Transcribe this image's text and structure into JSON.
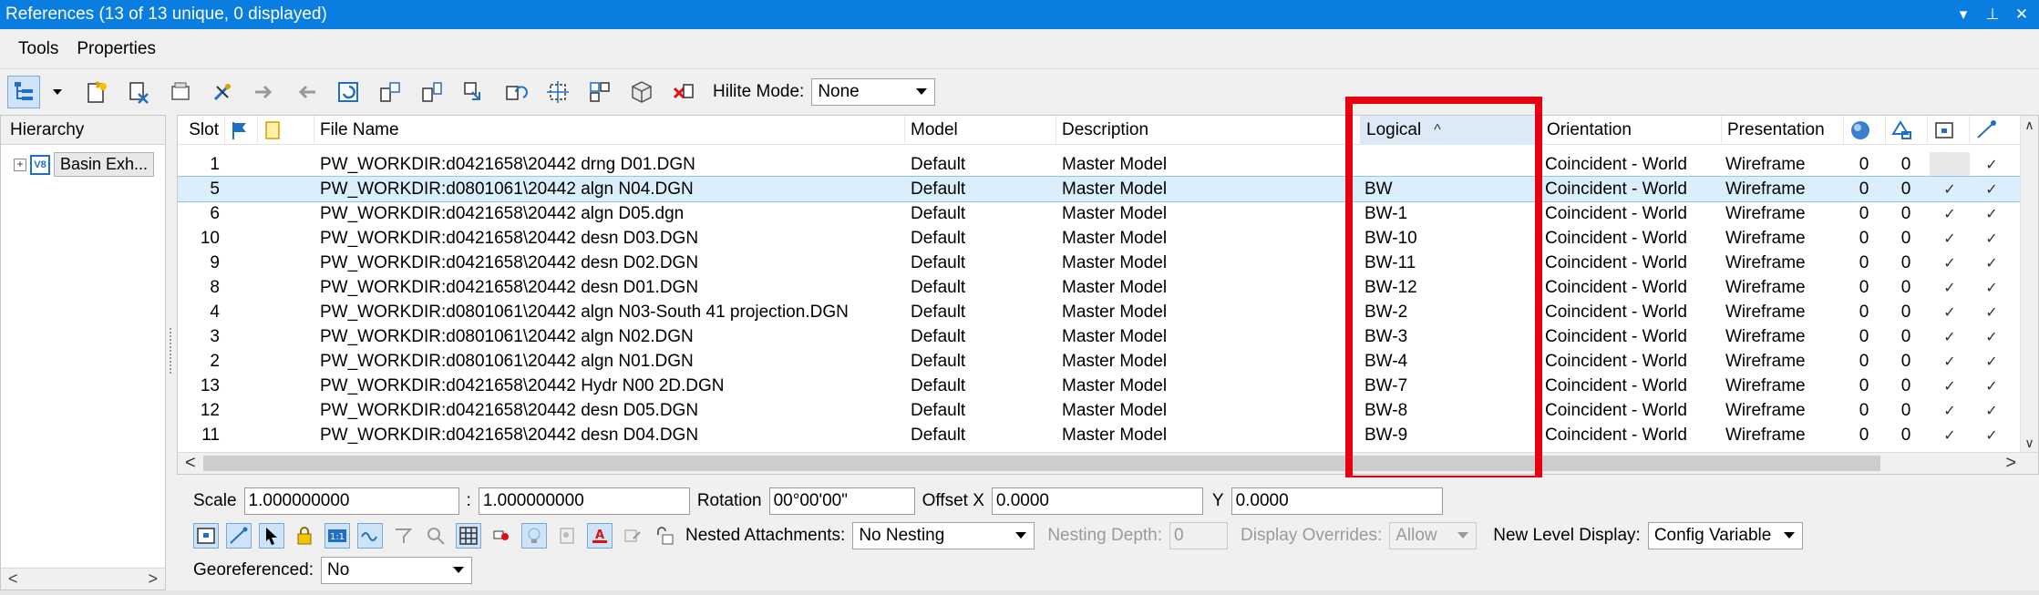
{
  "window": {
    "title": "References (13 of 13 unique, 0 displayed)",
    "dropdown_glyph": "▾",
    "pin_glyph": "⊥",
    "close_glyph": "✕"
  },
  "menu": {
    "items": [
      "Tools",
      "Properties"
    ]
  },
  "toolbar": {
    "hilite_label": "Hilite Mode:",
    "hilite_value": "None"
  },
  "hierarchy": {
    "header": "Hierarchy",
    "node_label": "Basin Exh...",
    "expander": "+",
    "node_icon_text": "V8"
  },
  "table": {
    "columns": [
      {
        "key": "slot",
        "label": "Slot"
      },
      {
        "key": "flag",
        "label": "",
        "icon": "flag-icon"
      },
      {
        "key": "note",
        "label": "",
        "icon": "note-icon"
      },
      {
        "key": "file",
        "label": "File Name"
      },
      {
        "key": "model",
        "label": "Model"
      },
      {
        "key": "desc",
        "label": "Description"
      },
      {
        "key": "logical",
        "label": "Logical",
        "sorted": "ascending"
      },
      {
        "key": "orient",
        "label": "Orientation"
      },
      {
        "key": "pres",
        "label": "Presentation"
      },
      {
        "key": "c1",
        "label": "",
        "icon": "sphere-icon"
      },
      {
        "key": "c2",
        "label": "",
        "icon": "shapes-icon"
      },
      {
        "key": "c3",
        "label": "",
        "icon": "display-icon"
      },
      {
        "key": "c4",
        "label": "",
        "icon": "snap-icon"
      }
    ],
    "sort_indicator": "^",
    "rows": [
      {
        "slot": "1",
        "file": "PW_WORKDIR:d0421658\\20442 drng D01.DGN",
        "model": "Default",
        "desc": "Master Model",
        "logical": "",
        "orient": "Coincident - World",
        "pres": "Wireframe",
        "c1": "0",
        "c2": "0",
        "c3": "",
        "c4": "✓"
      },
      {
        "slot": "5",
        "file": "PW_WORKDIR:d0801061\\20442 algn N04.DGN",
        "model": "Default",
        "desc": "Master Model",
        "logical": "BW",
        "orient": "Coincident - World",
        "pres": "Wireframe",
        "c1": "0",
        "c2": "0",
        "c3": "✓",
        "c4": "✓",
        "selected": true
      },
      {
        "slot": "6",
        "file": "PW_WORKDIR:d0421658\\20442 algn D05.dgn",
        "model": "Default",
        "desc": "Master Model",
        "logical": "BW-1",
        "orient": "Coincident - World",
        "pres": "Wireframe",
        "c1": "0",
        "c2": "0",
        "c3": "✓",
        "c4": "✓"
      },
      {
        "slot": "10",
        "file": "PW_WORKDIR:d0421658\\20442 desn D03.DGN",
        "model": "Default",
        "desc": "Master Model",
        "logical": "BW-10",
        "orient": "Coincident - World",
        "pres": "Wireframe",
        "c1": "0",
        "c2": "0",
        "c3": "✓",
        "c4": "✓"
      },
      {
        "slot": "9",
        "file": "PW_WORKDIR:d0421658\\20442 desn D02.DGN",
        "model": "Default",
        "desc": "Master Model",
        "logical": "BW-11",
        "orient": "Coincident - World",
        "pres": "Wireframe",
        "c1": "0",
        "c2": "0",
        "c3": "✓",
        "c4": "✓"
      },
      {
        "slot": "8",
        "file": "PW_WORKDIR:d0421658\\20442 desn D01.DGN",
        "model": "Default",
        "desc": "Master Model",
        "logical": "BW-12",
        "orient": "Coincident - World",
        "pres": "Wireframe",
        "c1": "0",
        "c2": "0",
        "c3": "✓",
        "c4": "✓"
      },
      {
        "slot": "4",
        "file": "PW_WORKDIR:d0801061\\20442 algn N03-South 41 projection.DGN",
        "model": "Default",
        "desc": "Master Model",
        "logical": "BW-2",
        "orient": "Coincident - World",
        "pres": "Wireframe",
        "c1": "0",
        "c2": "0",
        "c3": "✓",
        "c4": "✓"
      },
      {
        "slot": "3",
        "file": "PW_WORKDIR:d0801061\\20442 algn N02.DGN",
        "model": "Default",
        "desc": "Master Model",
        "logical": "BW-3",
        "orient": "Coincident - World",
        "pres": "Wireframe",
        "c1": "0",
        "c2": "0",
        "c3": "✓",
        "c4": "✓"
      },
      {
        "slot": "2",
        "file": "PW_WORKDIR:d0801061\\20442 algn N01.DGN",
        "model": "Default",
        "desc": "Master Model",
        "logical": "BW-4",
        "orient": "Coincident - World",
        "pres": "Wireframe",
        "c1": "0",
        "c2": "0",
        "c3": "✓",
        "c4": "✓"
      },
      {
        "slot": "13",
        "file": "PW_WORKDIR:d0421658\\20442 Hydr N00 2D.DGN",
        "model": "Default",
        "desc": "Master Model",
        "logical": "BW-7",
        "orient": "Coincident - World",
        "pres": "Wireframe",
        "c1": "0",
        "c2": "0",
        "c3": "✓",
        "c4": "✓"
      },
      {
        "slot": "12",
        "file": "PW_WORKDIR:d0421658\\20442 desn D05.DGN",
        "model": "Default",
        "desc": "Master Model",
        "logical": "BW-8",
        "orient": "Coincident - World",
        "pres": "Wireframe",
        "c1": "0",
        "c2": "0",
        "c3": "✓",
        "c4": "✓"
      },
      {
        "slot": "11",
        "file": "PW_WORKDIR:d0421658\\20442 desn D04.DGN",
        "model": "Default",
        "desc": "Master Model",
        "logical": "BW-9",
        "orient": "Coincident - World",
        "pres": "Wireframe",
        "c1": "0",
        "c2": "0",
        "c3": "✓",
        "c4": "✓"
      }
    ],
    "scroll_left": "<",
    "scroll_right": ">",
    "scroll_up": "∧",
    "scroll_down": "∨"
  },
  "props": {
    "scale_label": "Scale",
    "scale_a": "1.000000000",
    "scale_sep": ":",
    "scale_b": "1.000000000",
    "rotation_label": "Rotation",
    "rotation_value": "00°00'00\"",
    "offset_x_label": "Offset X",
    "offset_x_value": "0.0000",
    "offset_y_label": "Y",
    "offset_y_value": "0.0000",
    "nested_label": "Nested Attachments:",
    "nested_value": "No Nesting",
    "nesting_depth_label": "Nesting Depth:",
    "nesting_depth_value": "0",
    "display_overrides_label": "Display Overrides:",
    "display_overrides_value": "Allow",
    "new_level_label": "New Level Display:",
    "new_level_value": "Config Variable",
    "georef_label": "Georeferenced:",
    "georef_value": "No"
  },
  "hier_scroll": {
    "left": "<",
    "right": ">"
  },
  "colors": {
    "titlebar": "#0a7ee0",
    "highlight": "#e60012",
    "selected_row": "#dbeefb"
  }
}
